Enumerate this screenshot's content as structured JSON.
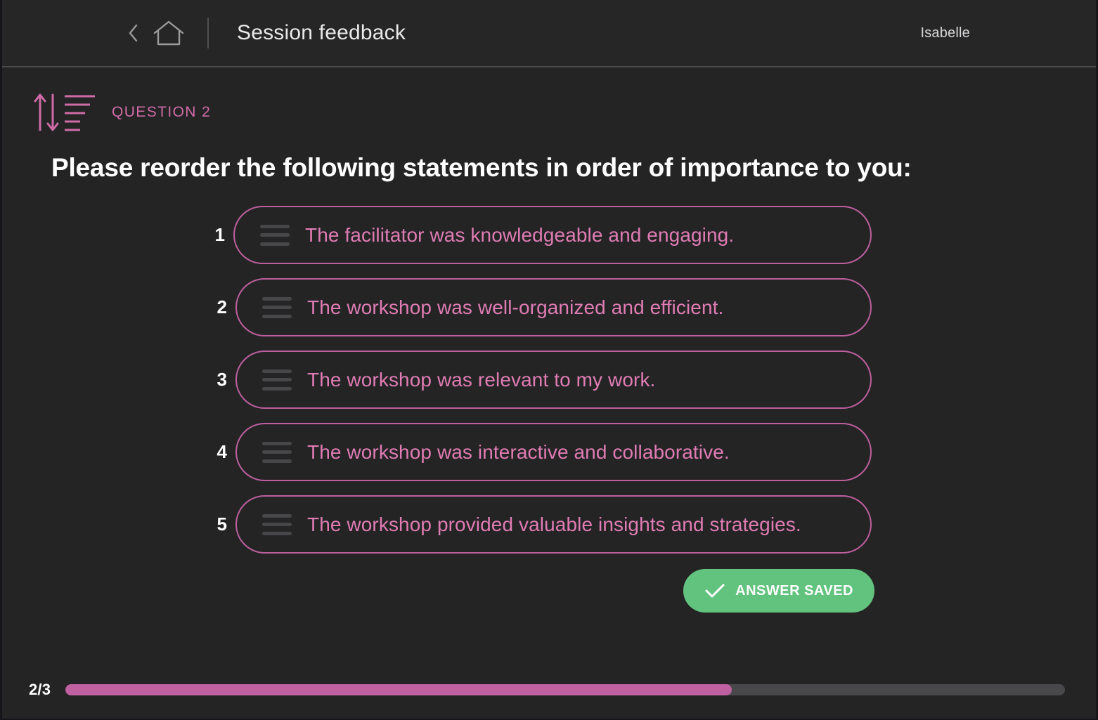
{
  "header": {
    "back_icon": "chevron-left-icon",
    "home_icon": "home-icon",
    "title": "Session feedback",
    "user": "Isabelle"
  },
  "question": {
    "icon": "sort-reorder-icon",
    "label": "QUESTION 2",
    "prompt": "Please reorder the following statements in order of importance to you:",
    "items": [
      {
        "index": "1",
        "text": "The facilitator was knowledgeable and engaging.",
        "handle_icon": "drag-handle-icon"
      },
      {
        "index": "2",
        "text": "The workshop was well-organized and efficient.",
        "handle_icon": "drag-handle-icon"
      },
      {
        "index": "3",
        "text": "The workshop was relevant to my work.",
        "handle_icon": "drag-handle-icon"
      },
      {
        "index": "4",
        "text": "The workshop was interactive and collaborative.",
        "handle_icon": "drag-handle-icon"
      },
      {
        "index": "5",
        "text": "The workshop provided valuable insights and strategies.",
        "handle_icon": "drag-handle-icon"
      }
    ]
  },
  "saved_button": {
    "label": "ANSWER SAVED",
    "icon": "check-icon",
    "color": "#62c37e"
  },
  "progress": {
    "label": "2/3",
    "percent": 66.7,
    "fill_color": "#bf60a0",
    "track_color": "#48484a"
  },
  "colors": {
    "background": "#242425",
    "header_background": "#262627",
    "accent_pink": "#bd5f9e",
    "text_pink": "#e07cb4",
    "text_white": "#ffffff",
    "grip_gray": "#474749"
  }
}
